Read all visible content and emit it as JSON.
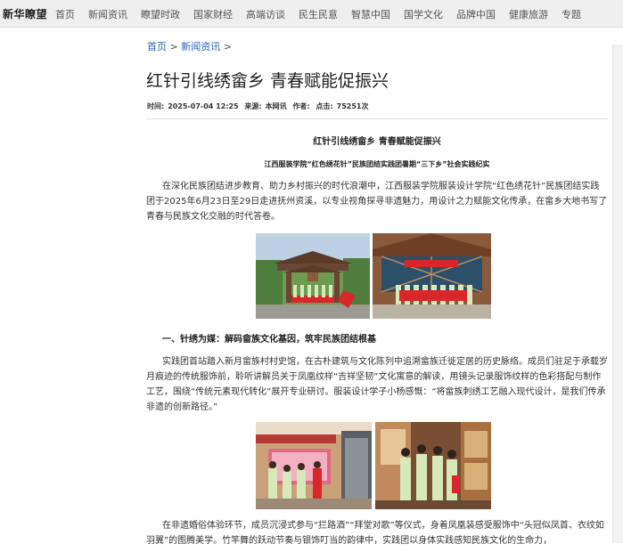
{
  "site": {
    "logo": "新华瞭望",
    "nav": [
      "首页",
      "新闻资讯",
      "瞭望时政",
      "国家财经",
      "高端访谈",
      "民生民意",
      "智慧中国",
      "国学文化",
      "品牌中国",
      "健康旅游",
      "专题"
    ]
  },
  "breadcrumb": {
    "home": "首页",
    "sep1": ">",
    "section": "新闻资讯",
    "sep2": ">"
  },
  "article": {
    "title": "红针引线绣畲乡 青春赋能促振兴",
    "meta": {
      "time_label": "时间:",
      "time": "2025-07-04 12:25",
      "source_label": "来源:",
      "source": "本网讯",
      "author_label": "作者:",
      "clicks_label": "点击:",
      "clicks": "75251次"
    },
    "subtitle": "红针引线绣畲乡 青春赋能促振兴",
    "subtitle2": "江西服装学院“红色绣花针”民族团结实践团暑期“三下乡”社会实践纪实",
    "paragraph1": "在深化民族团结进步教育、助力乡村振兴的时代浪潮中，江西服装学院服装设计学院“红色绣花针”民族团结实践团于2025年6月23日至29日走进抚州资溪，以专业视角探寻非遗魅力，用设计之力赋能文化传承，在畲乡大地书写了青春与民族文化交融的时代答卷。",
    "section1": "一、针绣为媒：解码畲族文化基因，筑牢民族团结根基",
    "paragraph2": "实践团首站踏入新月畲族村村史馆，在古朴建筑与文化陈列中追溯畲族迁徙定居的历史脉络。成员们驻足于承载岁月痕迹的传统服饰前，聆听讲解员关于凤凰纹样“吉祥坚韧”文化寓意的解读，用镜头记录服饰纹样的色彩搭配与制作工艺，围绕“传统元素现代转化”展开专业研讨。服装设计学子小杨感慨：“将畲族刺绣工艺融入现代设计，是我们传承非遗的创新路径。”",
    "paragraph3": "在非遗婚俗体验环节，成员沉浸式参与“拦路酒”“拜堂对歌”等仪式，身着凤凰装感受服饰中“头冠似凤首、衣纹如羽翼”的图腾美学。竹竿舞的跃动节奏与银饰叮当的韵律中，实践团以身体实践感知民族文化的生命力，"
  },
  "photos": [
    {
      "icon": "photo-village-gate-icon"
    },
    {
      "icon": "photo-team-banner-icon"
    },
    {
      "icon": "photo-museum-exhibit-icon"
    },
    {
      "icon": "photo-museum-visit-icon"
    }
  ],
  "colors": {
    "nav_bg": "#efefef",
    "link": "#2a63b4",
    "banner_red": "#d8262b",
    "shirt_green": "#d7e9b8"
  }
}
